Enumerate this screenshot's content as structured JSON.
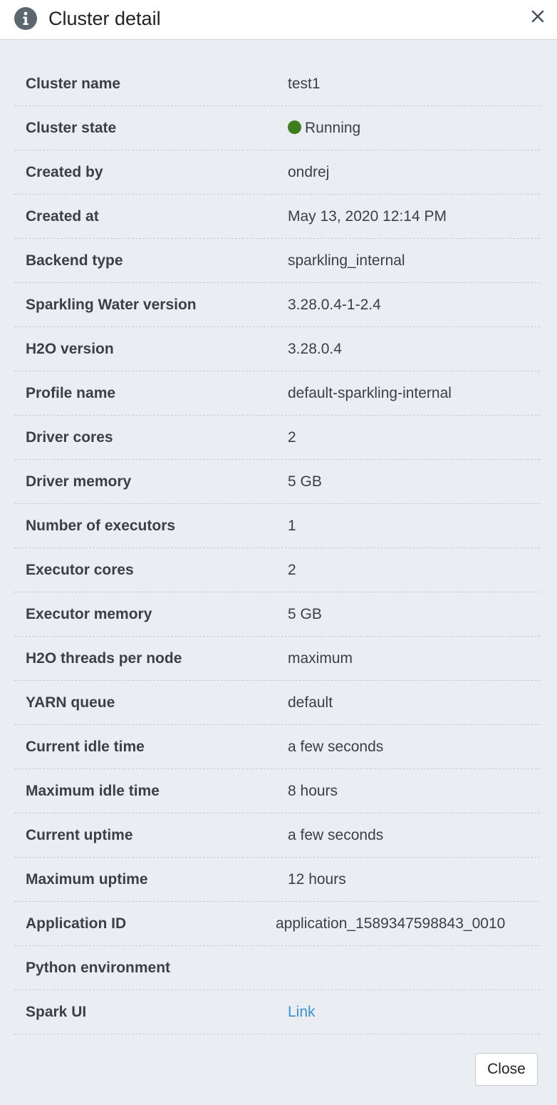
{
  "header": {
    "title": "Cluster detail",
    "info_icon": "info-circle-icon",
    "close_icon": "close-icon"
  },
  "details": {
    "cluster_name": {
      "label": "Cluster name",
      "value": "test1"
    },
    "cluster_state": {
      "label": "Cluster state",
      "value": "Running",
      "status_color": "#3e7d1b"
    },
    "created_by": {
      "label": "Created by",
      "value": "ondrej"
    },
    "created_at": {
      "label": "Created at",
      "value": "May 13, 2020 12:14 PM"
    },
    "backend_type": {
      "label": "Backend type",
      "value": "sparkling_internal"
    },
    "sparkling_water_version": {
      "label": "Sparkling Water version",
      "value": "3.28.0.4-1-2.4"
    },
    "h2o_version": {
      "label": "H2O version",
      "value": "3.28.0.4"
    },
    "profile_name": {
      "label": "Profile name",
      "value": "default-sparkling-internal"
    },
    "driver_cores": {
      "label": "Driver cores",
      "value": "2"
    },
    "driver_memory": {
      "label": "Driver memory",
      "value": "5 GB"
    },
    "number_of_executors": {
      "label": "Number of executors",
      "value": "1"
    },
    "executor_cores": {
      "label": "Executor cores",
      "value": "2"
    },
    "executor_memory": {
      "label": "Executor memory",
      "value": "5 GB"
    },
    "h2o_threads_per_node": {
      "label": "H2O threads per node",
      "value": "maximum"
    },
    "yarn_queue": {
      "label": "YARN queue",
      "value": "default"
    },
    "current_idle_time": {
      "label": "Current idle time",
      "value": "a few seconds"
    },
    "maximum_idle_time": {
      "label": "Maximum idle time",
      "value": "8 hours"
    },
    "current_uptime": {
      "label": "Current uptime",
      "value": "a few seconds"
    },
    "maximum_uptime": {
      "label": "Maximum uptime",
      "value": "12 hours"
    },
    "application_id": {
      "label": "Application ID",
      "value": "application_1589347598843_0010"
    },
    "python_environment": {
      "label": "Python environment",
      "value": ""
    },
    "spark_ui": {
      "label": "Spark UI",
      "value": "Link"
    }
  },
  "footer": {
    "close_label": "Close"
  },
  "colors": {
    "link": "#3b8fd6",
    "status_running": "#3e7d1b"
  }
}
